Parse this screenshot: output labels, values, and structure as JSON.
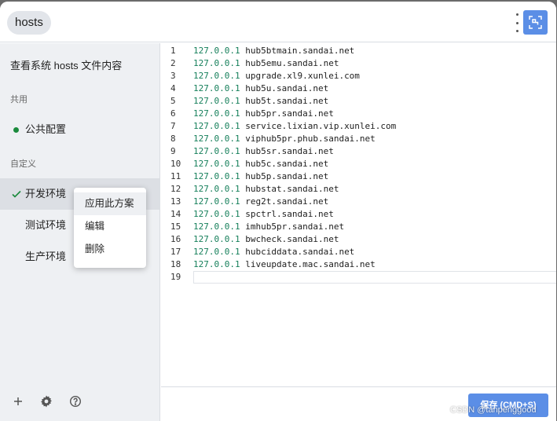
{
  "window": {
    "title": "hosts"
  },
  "sidebar": {
    "heading": "查看系统 hosts 文件内容",
    "sections": {
      "shared": "共用",
      "custom": "自定义"
    },
    "shared_items": [
      {
        "label": "公共配置",
        "active": true
      }
    ],
    "custom_items": [
      {
        "label": "开发环境",
        "selected": true
      },
      {
        "label": "测试环境",
        "selected": false
      },
      {
        "label": "生产环境",
        "selected": false
      }
    ],
    "footer_icons": [
      "add-icon",
      "gear-icon",
      "help-icon"
    ]
  },
  "context_menu": {
    "items": [
      "应用此方案",
      "编辑",
      "删除"
    ]
  },
  "editor": {
    "lines": [
      {
        "n": "1",
        "ip": "127.0.0.1",
        "host": "hub5btmain.sandai.net"
      },
      {
        "n": "2",
        "ip": "127.0.0.1",
        "host": "hub5emu.sandai.net"
      },
      {
        "n": "3",
        "ip": "127.0.0.1",
        "host": "upgrade.xl9.xunlei.com"
      },
      {
        "n": "4",
        "ip": "127.0.0.1",
        "host": "hub5u.sandai.net"
      },
      {
        "n": "5",
        "ip": "127.0.0.1",
        "host": "hub5t.sandai.net"
      },
      {
        "n": "6",
        "ip": "127.0.0.1",
        "host": "hub5pr.sandai.net"
      },
      {
        "n": "7",
        "ip": "127.0.0.1",
        "host": "service.lixian.vip.xunlei.com"
      },
      {
        "n": "8",
        "ip": "127.0.0.1",
        "host": "viphub5pr.phub.sandai.net"
      },
      {
        "n": "9",
        "ip": "127.0.0.1",
        "host": "hub5sr.sandai.net"
      },
      {
        "n": "10",
        "ip": "127.0.0.1",
        "host": "hub5c.sandai.net"
      },
      {
        "n": "11",
        "ip": "127.0.0.1",
        "host": "hub5p.sandai.net"
      },
      {
        "n": "12",
        "ip": "127.0.0.1",
        "host": "hubstat.sandai.net"
      },
      {
        "n": "13",
        "ip": "127.0.0.1",
        "host": "reg2t.sandai.net"
      },
      {
        "n": "14",
        "ip": "127.0.0.1",
        "host": "spctrl.sandai.net"
      },
      {
        "n": "15",
        "ip": "127.0.0.1",
        "host": "imhub5pr.sandai.net"
      },
      {
        "n": "16",
        "ip": "127.0.0.1",
        "host": "bwcheck.sandai.net"
      },
      {
        "n": "17",
        "ip": "127.0.0.1",
        "host": "hubciddata.sandai.net"
      },
      {
        "n": "18",
        "ip": "127.0.0.1",
        "host": "liveupdate.mac.sandai.net"
      },
      {
        "n": "19",
        "ip": "",
        "host": ""
      }
    ]
  },
  "actions": {
    "save_label": "保存 (CMD+S)"
  },
  "watermark": "CSDN @tanpenggood",
  "colors": {
    "accent": "#5b8ee6",
    "ip_green": "#157f5a",
    "active_dot": "#1a8a3c"
  }
}
